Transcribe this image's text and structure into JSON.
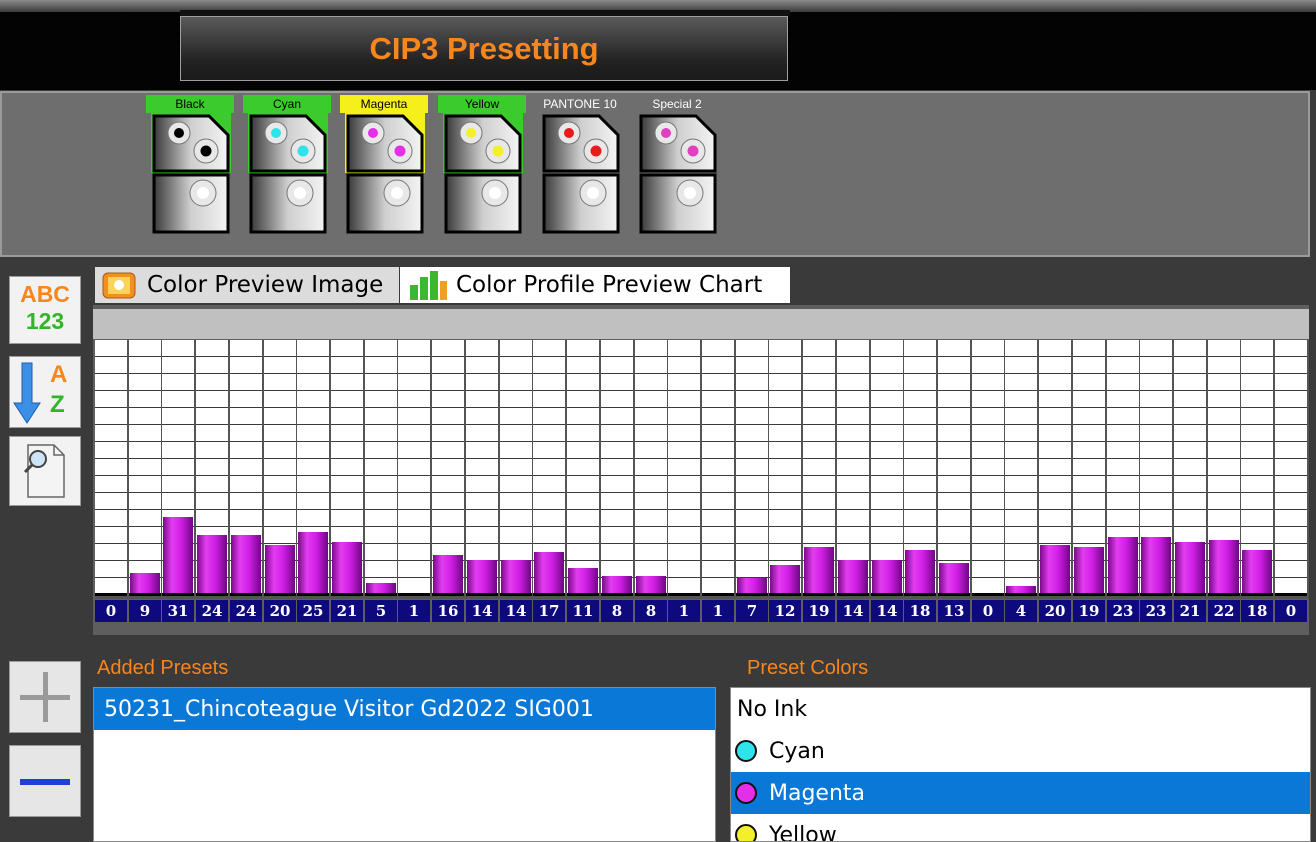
{
  "title": "CIP3 Presetting",
  "inks": [
    {
      "label": "Black",
      "state": "active",
      "dot": "#000000"
    },
    {
      "label": "Cyan",
      "state": "active",
      "dot": "#2fe3ec"
    },
    {
      "label": "Magenta",
      "state": "yellow",
      "dot": "#e52ee8"
    },
    {
      "label": "Yellow",
      "state": "active",
      "dot": "#f3f029"
    },
    {
      "label": "PANTONE 10",
      "state": "plain",
      "dot": "#e81a1a"
    },
    {
      "label": "Special 2",
      "state": "plain",
      "dot": "#e040c0"
    }
  ],
  "side_buttons": {
    "abc": "ABC",
    "num": "123",
    "sort_a": "A",
    "sort_z": "Z"
  },
  "tabs": [
    {
      "label": "Color Preview Image",
      "active": false,
      "icon": "image-icon"
    },
    {
      "label": "Color Profile Preview Chart",
      "active": true,
      "icon": "bar-chart-icon"
    }
  ],
  "chart_data": {
    "type": "bar",
    "values": [
      0,
      9,
      31,
      24,
      24,
      20,
      25,
      21,
      5,
      1,
      16,
      14,
      14,
      17,
      11,
      8,
      8,
      1,
      1,
      7,
      12,
      19,
      14,
      14,
      18,
      13,
      0,
      4,
      20,
      19,
      23,
      23,
      21,
      22,
      18,
      0
    ],
    "ylim": [
      0,
      100
    ],
    "bar_color": "#d21ee6"
  },
  "added_presets": {
    "label": "Added Presets",
    "items": [
      "50231_Chincoteague Visitor Gd2022 SIG001"
    ]
  },
  "preset_colors": {
    "label": "Preset Colors",
    "items": [
      {
        "label": "No Ink",
        "color": null,
        "selected": false
      },
      {
        "label": "Cyan",
        "color": "#2fe3ec",
        "selected": false
      },
      {
        "label": "Magenta",
        "color": "#e52ee8",
        "selected": true
      },
      {
        "label": "Yellow",
        "color": "#f3f029",
        "selected": false
      }
    ]
  },
  "colors": {
    "accent": "#f7861c",
    "selection": "#0a78d7",
    "value_bg": "#0e0a7e"
  }
}
